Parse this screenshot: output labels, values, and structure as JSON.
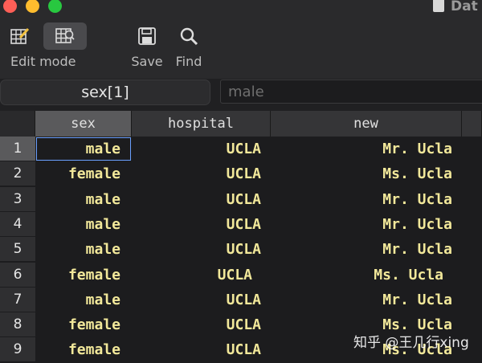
{
  "window": {
    "title": "Dat"
  },
  "toolbar": {
    "edit_mode_label": "Edit mode",
    "save_label": "Save",
    "find_label": "Find"
  },
  "formula_bar": {
    "cell_ref": "sex[1]",
    "cell_value": "male"
  },
  "table": {
    "columns": [
      "sex",
      "hospital",
      "new"
    ],
    "rows": [
      {
        "n": "1",
        "sex": "male",
        "hospital": "UCLA",
        "new": "Mr. Ucla"
      },
      {
        "n": "2",
        "sex": "female",
        "hospital": "UCLA",
        "new": "Ms. Ucla"
      },
      {
        "n": "3",
        "sex": "male",
        "hospital": "UCLA",
        "new": "Mr. Ucla"
      },
      {
        "n": "4",
        "sex": "male",
        "hospital": "UCLA",
        "new": "Mr. Ucla"
      },
      {
        "n": "5",
        "sex": "male",
        "hospital": "UCLA",
        "new": "Mr. Ucla"
      },
      {
        "n": "6",
        "sex": "female",
        "hospital": "UCLA",
        "new": "Ms. Ucla"
      },
      {
        "n": "7",
        "sex": "male",
        "hospital": "UCLA",
        "new": "Mr. Ucla"
      },
      {
        "n": "8",
        "sex": "female",
        "hospital": "UCLA",
        "new": "Ms. Ucla"
      },
      {
        "n": "9",
        "sex": "female",
        "hospital": "UCLA",
        "new": "Ms. Ucla"
      }
    ]
  },
  "watermark": "知乎 @王几行xing"
}
